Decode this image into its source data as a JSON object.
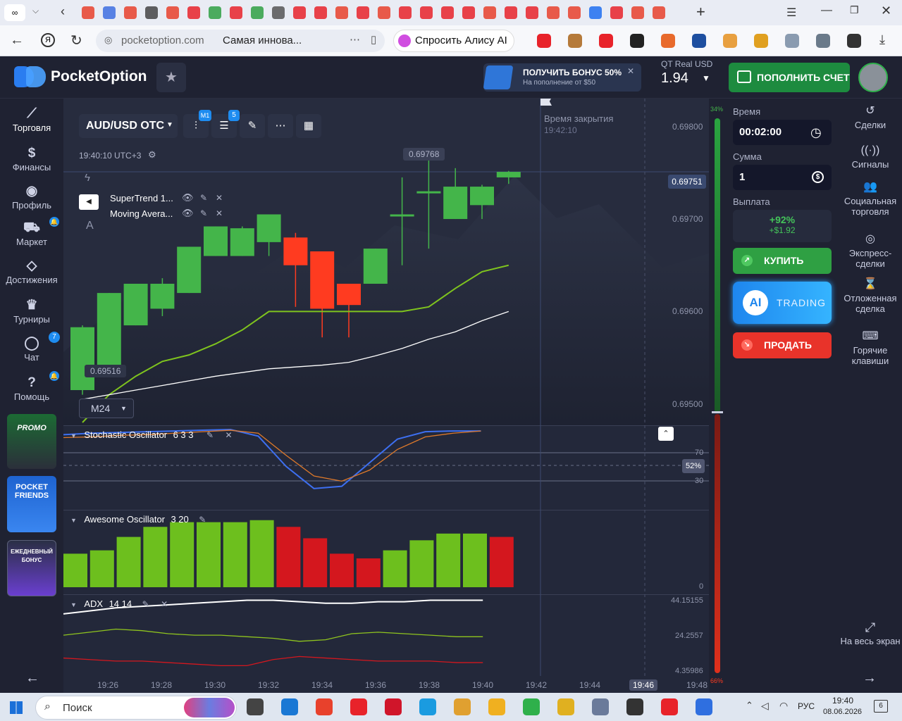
{
  "browser": {
    "url": "pocketoption.com",
    "page_title": "Самая иннова...",
    "alice_label": "Спросить Алису AI"
  },
  "header": {
    "logo": "PocketOption",
    "bonus_title": "ПОЛУЧИТЬ БОНУС 50%",
    "bonus_sub": "На пополнение от $50",
    "account_type": "QT Real",
    "currency": "USD",
    "balance": "1.94",
    "deposit_label": "ПОПОЛНИТЬ СЧЕТ"
  },
  "left_nav": [
    {
      "label": "Торговля",
      "icon": "chart-icon"
    },
    {
      "label": "Финансы",
      "icon": "dollar-icon"
    },
    {
      "label": "Профиль",
      "icon": "user-icon"
    },
    {
      "label": "Маркет",
      "icon": "cart-icon"
    },
    {
      "label": "Достижения",
      "icon": "diamond-icon"
    },
    {
      "label": "Турниры",
      "icon": "trophy-icon"
    },
    {
      "label": "Чат",
      "icon": "chat-icon",
      "badge": "7"
    },
    {
      "label": "Помощь",
      "icon": "help-icon"
    }
  ],
  "promos": {
    "promo": "PROMO",
    "friends": "POCKET FRIENDS",
    "daily": "ЕЖЕДНЕВНЫЙ БОНУС"
  },
  "toolbar": {
    "asset": "AUD/USD OTC",
    "timeframe_badge": "M1",
    "indicators_badge": "5",
    "server_time": "19:40:10 UTC+3",
    "timeframe": "M24"
  },
  "legend": [
    {
      "name": "SuperTrend 1..."
    },
    {
      "name": "Moving Avera..."
    }
  ],
  "expiry": {
    "label": "Время закрытия",
    "time": "19:42:10"
  },
  "price_labels": {
    "high": "0.69768",
    "low": "0.69516",
    "current": "0.69751"
  },
  "price_axis": [
    "0.69800",
    "0.69700",
    "0.69600",
    "0.69500"
  ],
  "stoch": {
    "title": "Stochastic Oscillator",
    "params": "6 3 3",
    "levels": [
      "70",
      "30"
    ],
    "value": "52%"
  },
  "ao": {
    "title": "Awesome Oscillator",
    "params": "3 20",
    "zero": "0"
  },
  "adx": {
    "title": "ADX",
    "params": "14 14",
    "levels": [
      "44.15155",
      "24.2557",
      "4.35986"
    ]
  },
  "time_axis": [
    "19:26",
    "19:28",
    "19:30",
    "19:32",
    "19:34",
    "19:36",
    "19:38",
    "19:40",
    "19:42",
    "19:44",
    "19:46",
    "19:48"
  ],
  "sentiment": {
    "up": "34%",
    "down": "66%"
  },
  "trade": {
    "time_label": "Время",
    "time_value": "00:02:00",
    "amount_label": "Сумма",
    "amount_value": "1",
    "payout_label": "Выплата",
    "payout_pct": "+92%",
    "payout_amt": "+$1.92",
    "buy_label": "КУПИТЬ",
    "ai_label": "AI",
    "ai_trading": "TRADING",
    "sell_label": "ПРОДАТЬ"
  },
  "right_nav": [
    {
      "label": "Сделки",
      "icon": "history-icon"
    },
    {
      "label": "Сигналы",
      "icon": "signal-icon"
    },
    {
      "label": "Социальная торговля",
      "icon": "people-icon"
    },
    {
      "label": "Экспресс-сделки",
      "icon": "target-icon"
    },
    {
      "label": "Отложенная сделка",
      "icon": "hourglass-icon"
    },
    {
      "label": "Горячие клавиши",
      "icon": "keyboard-icon"
    },
    {
      "label": "На весь экран",
      "icon": "fullscreen-icon"
    }
  ],
  "taskbar": {
    "search": "Поиск",
    "lang": "РУС",
    "time": "19:40",
    "date": "08.06.2026",
    "notif": "6"
  },
  "colors": {
    "up": "#44b54a",
    "down": "#ff3b20",
    "bg": "#23283a"
  },
  "chart_data": [
    {
      "type": "candlestick",
      "title": "AUD/USD OTC",
      "x": [
        "19:25",
        "19:26",
        "19:27",
        "19:28",
        "19:29",
        "19:30",
        "19:31",
        "19:32",
        "19:33",
        "19:34",
        "19:35",
        "19:36",
        "19:37",
        "19:38",
        "19:39",
        "19:40"
      ],
      "candles": [
        {
          "o": 0.69515,
          "h": 0.69585,
          "l": 0.6951,
          "c": 0.69583
        },
        {
          "o": 0.69537,
          "h": 0.6962,
          "l": 0.69537,
          "c": 0.6962
        },
        {
          "o": 0.69585,
          "h": 0.6963,
          "l": 0.69585,
          "c": 0.6963
        },
        {
          "o": 0.69603,
          "h": 0.69636,
          "l": 0.69595,
          "c": 0.6963
        },
        {
          "o": 0.6962,
          "h": 0.6967,
          "l": 0.6962,
          "c": 0.6967
        },
        {
          "o": 0.6966,
          "h": 0.69692,
          "l": 0.6966,
          "c": 0.69692
        },
        {
          "o": 0.6966,
          "h": 0.69692,
          "l": 0.6966,
          "c": 0.6969
        },
        {
          "o": 0.69675,
          "h": 0.69705,
          "l": 0.6966,
          "c": 0.69705
        },
        {
          "o": 0.6968,
          "h": 0.69685,
          "l": 0.69605,
          "c": 0.6965
        },
        {
          "o": 0.69665,
          "h": 0.69665,
          "l": 0.69572,
          "c": 0.69603
        },
        {
          "o": 0.6963,
          "h": 0.6963,
          "l": 0.69572,
          "c": 0.69607
        },
        {
          "o": 0.6963,
          "h": 0.69668,
          "l": 0.6963,
          "c": 0.69668
        },
        {
          "o": 0.69705,
          "h": 0.69745,
          "l": 0.6965,
          "c": 0.69705
        },
        {
          "o": 0.6973,
          "h": 0.69768,
          "l": 0.69668,
          "c": 0.6973
        },
        {
          "o": 0.697,
          "h": 0.69755,
          "l": 0.697,
          "c": 0.69735
        },
        {
          "o": 0.69715,
          "h": 0.69737,
          "l": 0.697,
          "c": 0.69735
        },
        {
          "o": 0.69745,
          "h": 0.69752,
          "l": 0.69738,
          "c": 0.69751
        }
      ],
      "supertrend": [
        0.6948,
        0.6951,
        0.6953,
        0.69546,
        0.69553,
        0.69565,
        0.6958,
        0.696,
        0.696,
        0.696,
        0.696,
        0.696,
        0.696,
        0.69605,
        0.69625,
        0.69643,
        0.6965
      ],
      "moving_average": [
        0.69505,
        0.6951,
        0.69515,
        0.6952,
        0.69525,
        0.6953,
        0.69534,
        0.69538,
        0.6954,
        0.69542,
        0.69545,
        0.69552,
        0.6956,
        0.6957,
        0.69578,
        0.6959,
        0.696
      ],
      "ylim": [
        0.6948,
        0.69815
      ]
    },
    {
      "type": "line",
      "title": "Stochastic Oscillator",
      "series": [
        {
          "values": [
            98,
            100,
            101,
            102,
            103,
            104,
            105,
            96,
            55,
            25,
            28,
            60,
            92,
            102,
            103,
            103
          ]
        },
        {
          "values": [
            94,
            95,
            97,
            98,
            100,
            102,
            104,
            100,
            70,
            42,
            35,
            50,
            78,
            95,
            100,
            103
          ]
        }
      ],
      "levels": [
        70,
        30
      ],
      "ylim": [
        0,
        105
      ]
    },
    {
      "type": "bar",
      "title": "Awesome Oscillator",
      "values": [
        0.5,
        0.55,
        0.75,
        0.9,
        0.97,
        0.97,
        0.97,
        1.0,
        -0.9,
        -0.73,
        -0.5,
        -0.43,
        0.55,
        0.7,
        0.8,
        0.8,
        -0.75
      ],
      "ylim": [
        0,
        1.05
      ]
    },
    {
      "type": "line",
      "title": "ADX",
      "series": [
        {
          "values": [
            38,
            40,
            42,
            43,
            44,
            45,
            46,
            47,
            47,
            46,
            45,
            45,
            46,
            46,
            47,
            47,
            47
          ]
        },
        {
          "values": [
            24,
            26,
            28,
            27,
            25,
            24,
            24,
            23,
            22,
            20,
            21,
            25,
            26,
            25,
            24,
            23,
            23
          ]
        },
        {
          "values": [
            9,
            8,
            7,
            7,
            6,
            5,
            4,
            4,
            8,
            10,
            9,
            8,
            7,
            7,
            7,
            6,
            6
          ]
        }
      ],
      "levels": [
        44.15155,
        24.2557,
        4.35986
      ],
      "ylim": [
        0,
        50
      ]
    }
  ]
}
